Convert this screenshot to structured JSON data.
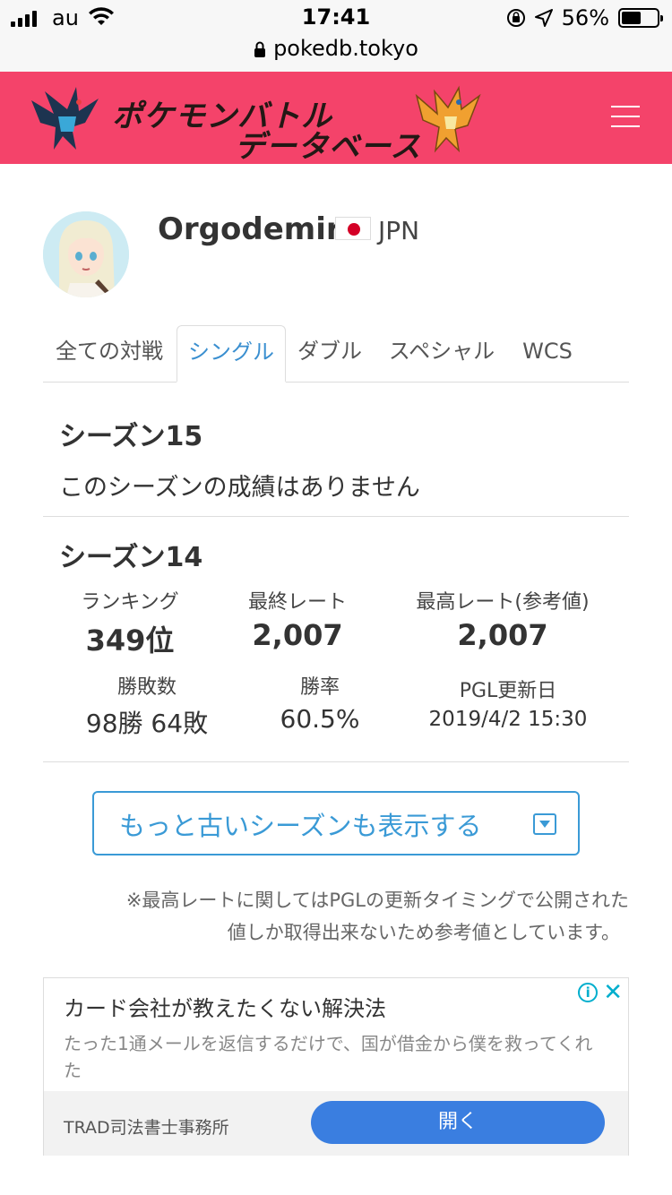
{
  "status_bar": {
    "carrier": "au",
    "time": "17:41",
    "url": "pokedb.tokyo",
    "battery": "56%",
    "battery_level": 0.56
  },
  "header": {
    "logo_line1": "ポケモンバトル",
    "logo_line2": "データベース",
    "brand_color": "#f4436a"
  },
  "profile": {
    "name": "Orgodemir",
    "country": "JPN"
  },
  "tabs": [
    {
      "label": "全ての対戦",
      "active": false
    },
    {
      "label": "シングル",
      "active": true
    },
    {
      "label": "ダブル",
      "active": false
    },
    {
      "label": "スペシャル",
      "active": false
    },
    {
      "label": "WCS",
      "active": false
    }
  ],
  "season15": {
    "title": "シーズン15",
    "message": "このシーズンの成績はありません"
  },
  "season14": {
    "title": "シーズン14",
    "ranking_label": "ランキング",
    "ranking_value": "349位",
    "final_rate_label": "最終レート",
    "final_rate_value": "2,007",
    "max_rate_label": "最高レート(参考値)",
    "max_rate_value": "2,007",
    "record_label": "勝敗数",
    "record_value": "98勝 64敗",
    "win_rate_label": "勝率",
    "win_rate_value": "60.5%",
    "pgl_label": "PGL更新日",
    "pgl_value": "2019/4/2 15:30"
  },
  "more_button": "もっと古いシーズンも表示する",
  "note": {
    "line1": "※最高レートに関してはPGLの更新タイミングで公開された",
    "line2": "値しか取得出来ないため参考値としています。"
  },
  "ad": {
    "title": "カード会社が教えたくない解決法",
    "body": "たった1通メールを返信するだけで、国が借金から僕を救ってくれた",
    "advertiser": "TRAD司法書士事務所",
    "cta": "開く",
    "accent": "#00aecd"
  }
}
